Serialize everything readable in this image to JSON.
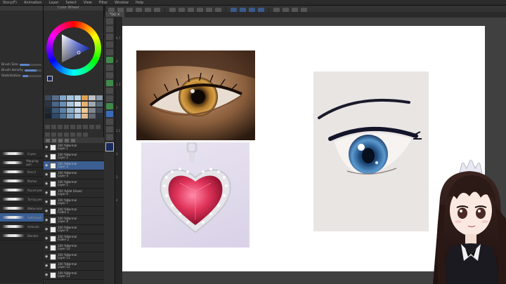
{
  "menubar": {
    "items": [
      "Story(F)",
      "Animation",
      "Layer",
      "Select",
      "View",
      "Filter",
      "Window",
      "Help"
    ]
  },
  "tabs": [
    {
      "label": "*(s) ×"
    }
  ],
  "color_panel": {
    "title": "Color Wheel",
    "current_color": "#1a2a5c",
    "palette": [
      "#3a4a5a",
      "#5a6e8a",
      "#7fa7c9",
      "#9ec2de",
      "#b8d2e6",
      "#e0a050",
      "#c0c0c0",
      "#8899aa",
      "#2a3545",
      "#4a6688",
      "#6a8fb5",
      "#a6c3db",
      "#d4e2ee",
      "#e8b070",
      "#a0a8b0",
      "#556677",
      "#1e2a38",
      "#3d5a7a",
      "#5d82a8",
      "#8fb0cc",
      "#c0d6e8",
      "#f0c890",
      "#808890",
      "#404a55",
      "#18222e",
      "#2f4a66",
      "#4e7295",
      "#7a9ebe",
      "#b0c8dc",
      "#dcb890",
      "#606870",
      "#2a323c"
    ]
  },
  "brush_settings": {
    "rows": [
      {
        "label": "Brush Size",
        "value": 0.45
      },
      {
        "label": "Brush density",
        "value": 0.7
      },
      {
        "label": "Stabilization",
        "value": 0.3
      }
    ]
  },
  "brushes": [
    {
      "label": "G-pen",
      "selected": false
    },
    {
      "label": "Mapping pen",
      "selected": false
    },
    {
      "label": "Pencil",
      "selected": false
    },
    {
      "label": "Marker",
      "selected": false
    },
    {
      "label": "Round pen",
      "selected": false
    },
    {
      "label": "Turnip pen",
      "selected": false
    },
    {
      "label": "Watercolor",
      "selected": false
    },
    {
      "label": "Soft brush",
      "selected": true
    },
    {
      "label": "Airbrush",
      "selected": false
    },
    {
      "label": "Blender",
      "selected": false
    }
  ],
  "layers": [
    {
      "name": "100 %Normal\nLayer 1",
      "selected": false
    },
    {
      "name": "100 %Normal\nLayer 2",
      "selected": false
    },
    {
      "name": "100 %Normal\nLayer 3",
      "selected": true
    },
    {
      "name": "100 %Normal\nLayer 4",
      "selected": false
    },
    {
      "name": "100 %Normal\nLayer 5",
      "selected": false
    },
    {
      "name": "100 %Add (Glow)\nLayer 6",
      "selected": false
    },
    {
      "name": "100 %Normal\nLayer 7",
      "selected": false
    },
    {
      "name": "100 %Normal\nFolder 1",
      "selected": false
    },
    {
      "name": "100 %Normal\nLayer 8",
      "selected": false
    },
    {
      "name": "100 %Normal\nLayer 9",
      "selected": false
    },
    {
      "name": "100 %Normal\nFolder 2",
      "selected": false
    },
    {
      "name": "100 %Normal\nLayer 10",
      "selected": false
    },
    {
      "name": "100 %Normal\nLayer 11",
      "selected": false
    },
    {
      "name": "100 %Normal\nLayer 12",
      "selected": false
    },
    {
      "name": "100 %Normal\nLayer 13",
      "selected": false
    }
  ],
  "side_numbers": [
    "6.7",
    "4",
    "1.3",
    "2",
    "2.5",
    "3",
    "3",
    "4"
  ],
  "toolbar": {
    "buttons": 20
  },
  "canvas": {
    "background": "#ffffff"
  }
}
